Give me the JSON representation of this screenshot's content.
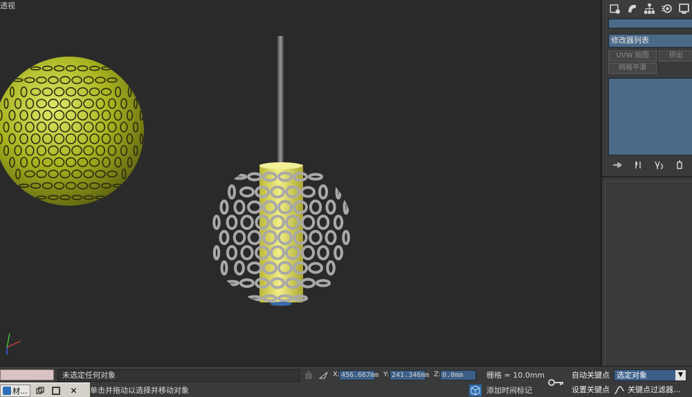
{
  "viewport": {
    "label": "透视"
  },
  "command_panel": {
    "tabs": [
      {
        "name": "create-icon"
      },
      {
        "name": "modify-icon"
      },
      {
        "name": "hierarchy-icon"
      },
      {
        "name": "motion-icon"
      },
      {
        "name": "display-icon"
      }
    ],
    "object_name": "",
    "modifier_list_label": "修改器列表",
    "buttons": {
      "uvw_map": "UVW 贴图",
      "extrude": "挤出",
      "mesh_smooth": "网格平滑"
    },
    "stack_tools": [
      {
        "name": "pin-stack-icon"
      },
      {
        "name": "show-end-result-icon"
      },
      {
        "name": "make-unique-icon"
      },
      {
        "name": "remove-modifier-icon"
      }
    ]
  },
  "status_bar": {
    "selection_status": "未选定任何对象",
    "prompt": "单击并拖动以选择并移动对象",
    "x_label": "X:",
    "x_value": "456.667mm",
    "y_label": "Y:",
    "y_value": "241.346mm",
    "z_label": "Z:",
    "z_value": "0.0mm",
    "grid": "栅格 = 10.0mm",
    "add_time_tag": "添加时间标记",
    "auto_key": "自动关键点",
    "set_key": "设置关键点",
    "key_mode_selected": "选定对象",
    "key_filters": "关键点过滤器..."
  },
  "taskbar": {
    "item_label": "材..."
  },
  "colors": {
    "viewport_bg": "#2a2a2a",
    "panel_bg": "#3a3a3a",
    "field_blue": "#4b6a88",
    "lamp_yellow": "#e6e26a",
    "ball_green": "#b5c02a",
    "wire_gray": "#8e8e8e"
  }
}
